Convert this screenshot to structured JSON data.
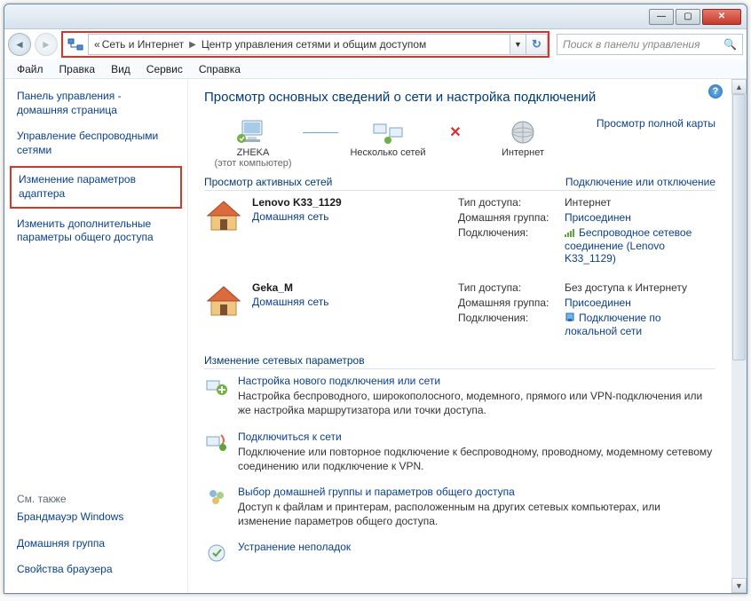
{
  "window": {
    "min": "—",
    "max": "▢",
    "close": "✕"
  },
  "address": {
    "prefix": "«",
    "crumb1": "Сеть и Интернет",
    "crumb2": "Центр управления сетями и общим доступом"
  },
  "search": {
    "placeholder": "Поиск в панели управления"
  },
  "menu": {
    "file": "Файл",
    "edit": "Правка",
    "view": "Вид",
    "tools": "Сервис",
    "help": "Справка"
  },
  "sidebar": {
    "home": "Панель управления - домашняя страница",
    "wireless": "Управление беспроводными сетями",
    "adapter": "Изменение параметров адаптера",
    "sharing": "Изменить дополнительные параметры общего доступа",
    "also": "См. также",
    "firewall": "Брандмауэр Windows",
    "homegroup": "Домашняя группа",
    "browser": "Свойства браузера"
  },
  "main": {
    "title": "Просмотр основных сведений о сети и настройка подключений",
    "map": {
      "node1_name": "ZHEKA",
      "node1_sub": "(этот компьютер)",
      "node2_name": "Несколько сетей",
      "node3_name": "Интернет",
      "full_map": "Просмотр полной карты"
    },
    "active_head": "Просмотр активных сетей",
    "connect_link": "Подключение или отключение",
    "labels": {
      "access": "Тип доступа:",
      "homegroup": "Домашняя группа:",
      "connections": "Подключения:"
    },
    "net1": {
      "name": "Lenovo K33_1129",
      "type": "Домашняя сеть",
      "access": "Интернет",
      "homegroup": "Присоединен",
      "conn": "Беспроводное сетевое соединение (Lenovo K33_1129)"
    },
    "net2": {
      "name": "Geka_M",
      "type": "Домашняя сеть",
      "access": "Без доступа к Интернету",
      "homegroup": "Присоединен",
      "conn": "Подключение по локальной сети"
    },
    "change_head": "Изменение сетевых параметров",
    "task1": {
      "link": "Настройка нового подключения или сети",
      "desc": "Настройка беспроводного, широкополосного, модемного, прямого или VPN-подключения или же настройка маршрутизатора или точки доступа."
    },
    "task2": {
      "link": "Подключиться к сети",
      "desc": "Подключение или повторное подключение к беспроводному, проводному, модемному сетевому соединению или подключение к VPN."
    },
    "task3": {
      "link": "Выбор домашней группы и параметров общего доступа",
      "desc": "Доступ к файлам и принтерам, расположенным на других сетевых компьютерах, или изменение параметров общего доступа."
    },
    "task4": {
      "link": "Устранение неполадок"
    }
  }
}
